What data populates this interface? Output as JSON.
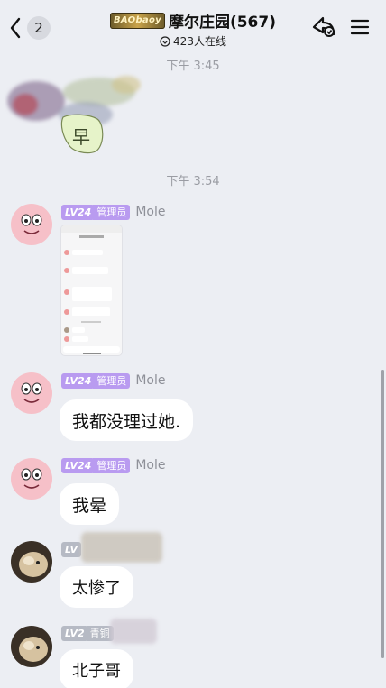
{
  "header": {
    "back_count": "2",
    "badge_text": "BAObaoy",
    "group_name": "摩尔庄园(567)",
    "online_text": "423人在线"
  },
  "chat": {
    "time1": "下午 3:45",
    "sticker_char": "早",
    "time2": "下午 3:54",
    "messages": [
      {
        "level": "LV24",
        "role": "管理员",
        "name": "Mole",
        "type": "image"
      },
      {
        "level": "LV24",
        "role": "管理员",
        "name": "Mole",
        "text": "我都没理过她."
      },
      {
        "level": "LV24",
        "role": "管理员",
        "name": "Mole",
        "text": "我晕"
      },
      {
        "level": "LV",
        "text": "太惨了"
      },
      {
        "level": "LV2",
        "role": "青铜",
        "text": "北子哥"
      }
    ]
  },
  "colors": {
    "background": "#eceef3",
    "bubble": "#ffffff",
    "level_tag": "#b99bf0",
    "time_text": "#9a9ca3"
  }
}
